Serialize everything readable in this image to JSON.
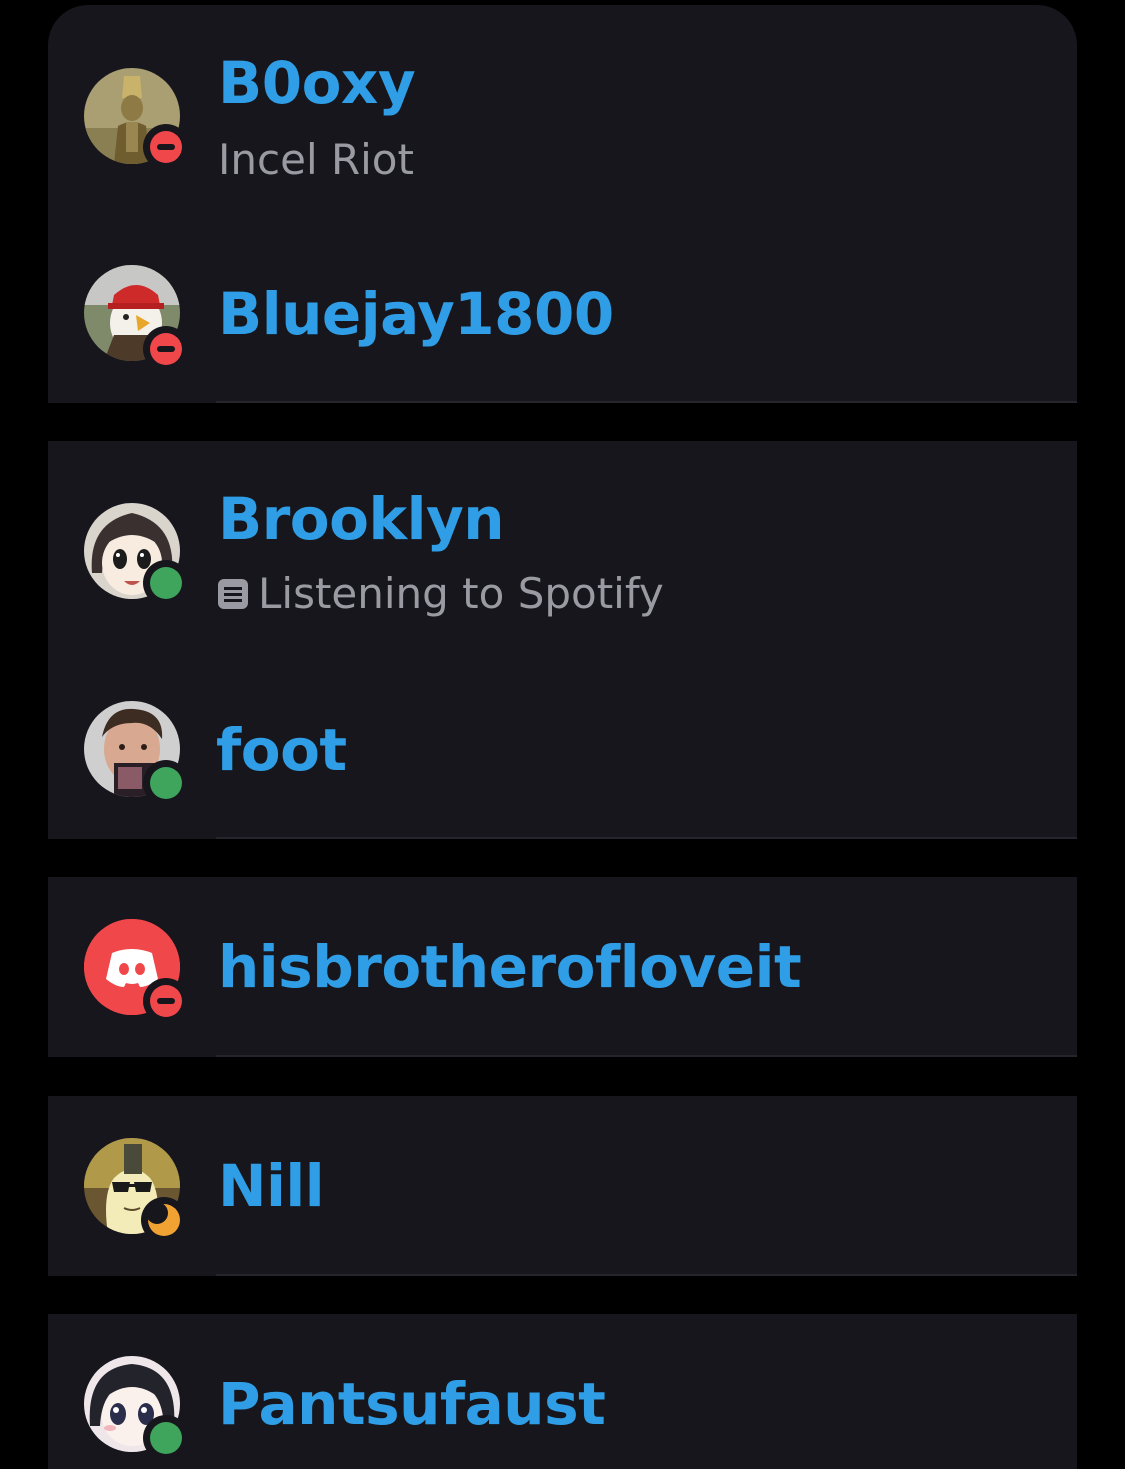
{
  "colors": {
    "background": "#000000",
    "card": "#16161c",
    "divider": "#25252d",
    "username": "#2f9ee6",
    "subtext": "#9a9aa3",
    "status_dnd": "#f0474b",
    "status_online": "#3fa45c",
    "status_idle": "#f0a232",
    "discord_default_avatar": "#f0474b"
  },
  "members": [
    {
      "username": "B0oxy",
      "status": "dnd",
      "custom_status": "Incel Riot",
      "avatar": "statue-avatar"
    },
    {
      "username": "Bluejay1800",
      "status": "dnd",
      "custom_status": "",
      "avatar": "eagle-hat-avatar"
    },
    {
      "username": "Brooklyn",
      "status": "online",
      "activity": "Listening to Spotify",
      "activity_icon": "activity-icon",
      "avatar": "anime-girl-avatar"
    },
    {
      "username": "foot",
      "status": "online",
      "custom_status": "",
      "avatar": "person-photo-avatar"
    },
    {
      "username": "hisbrotherofloveit",
      "status": "dnd",
      "custom_status": "",
      "avatar": "discord-default-avatar"
    },
    {
      "username": "Nill",
      "status": "idle",
      "custom_status": "",
      "avatar": "sunglasses-cartoon-avatar"
    },
    {
      "username": "Pantsufaust",
      "status": "online",
      "custom_status": "",
      "avatar": "anime-face-avatar"
    }
  ]
}
